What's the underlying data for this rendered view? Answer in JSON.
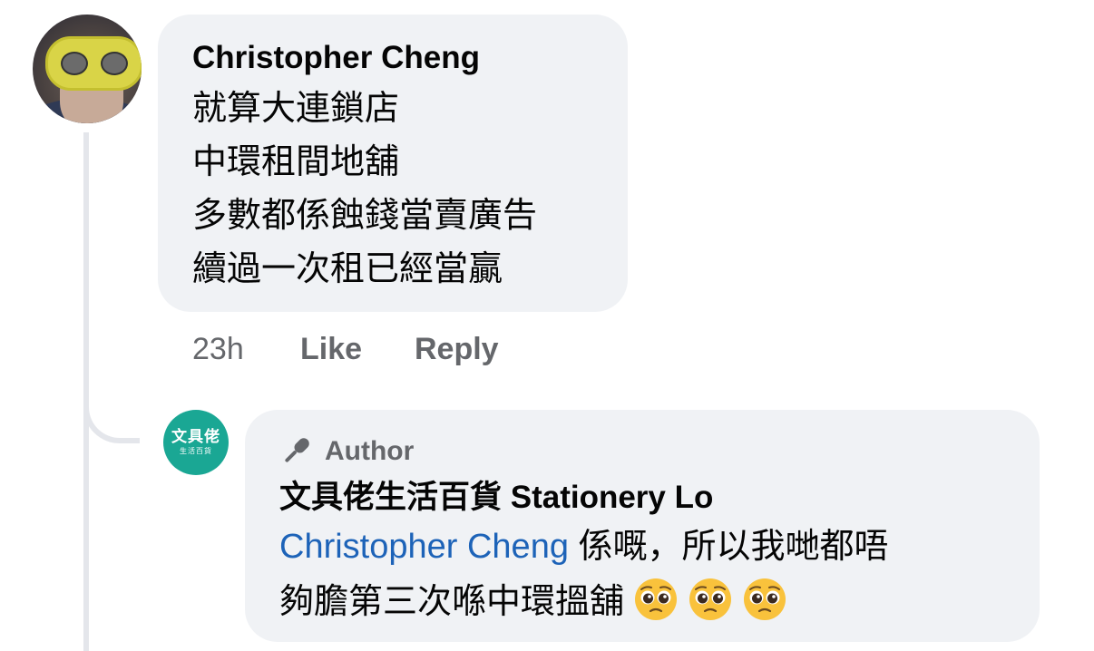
{
  "comment": {
    "author_name": "Christopher Cheng",
    "lines": [
      "就算大連鎖店",
      "中環租間地舖",
      "多數都係蝕錢當賣廣告",
      "續過一次租已經當贏"
    ],
    "time": "23h",
    "like_label": "Like",
    "reply_label": "Reply"
  },
  "reply": {
    "avatar_logo": "文具佬",
    "avatar_sub": "生活百貨",
    "badge_icon": "microphone-icon",
    "badge_label": "Author",
    "author_name": "文具佬生活百貨 Stationery Lo",
    "mention": "Christopher Cheng",
    "text_line_1": " 係嘅，所以我哋都唔",
    "text_line_2": "夠膽第三次喺中環搵舖",
    "emojis": [
      "pleading-face-emoji",
      "pleading-face-emoji",
      "pleading-face-emoji"
    ]
  },
  "colors": {
    "bubble_bg": "#f0f2f5",
    "mention": "#1d63b8",
    "secondary_text": "#65676b",
    "page_avatar_bg": "#1aa794"
  }
}
